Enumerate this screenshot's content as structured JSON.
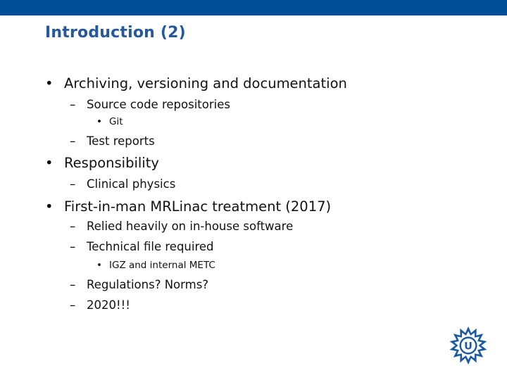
{
  "slide": {
    "title": "Introduction (2)",
    "header_bar_color": "#004e98",
    "title_color": "#25599c",
    "logo": {
      "icon": "university-sun-logo",
      "letter": "U",
      "color": "#1c5aa0"
    },
    "bullets": [
      {
        "level": 1,
        "marker": "•",
        "text": "Archiving, versioning and documentation"
      },
      {
        "level": 2,
        "marker": "–",
        "text": "Source code repositories"
      },
      {
        "level": 3,
        "marker": "•",
        "text": "Git"
      },
      {
        "level": 2,
        "marker": "–",
        "text": "Test reports"
      },
      {
        "level": 1,
        "marker": "•",
        "text": "Responsibility"
      },
      {
        "level": 2,
        "marker": "–",
        "text": "Clinical physics"
      },
      {
        "level": 1,
        "marker": "•",
        "text": "First-in-man MRLinac treatment (2017)"
      },
      {
        "level": 2,
        "marker": "–",
        "text": "Relied heavily on in-house software"
      },
      {
        "level": 2,
        "marker": "–",
        "text": "Technical file required"
      },
      {
        "level": 3,
        "marker": "•",
        "text": "IGZ and internal METC"
      },
      {
        "level": 2,
        "marker": "–",
        "text": "Regulations? Norms?"
      },
      {
        "level": 2,
        "marker": "–",
        "text": "2020!!!"
      }
    ]
  }
}
